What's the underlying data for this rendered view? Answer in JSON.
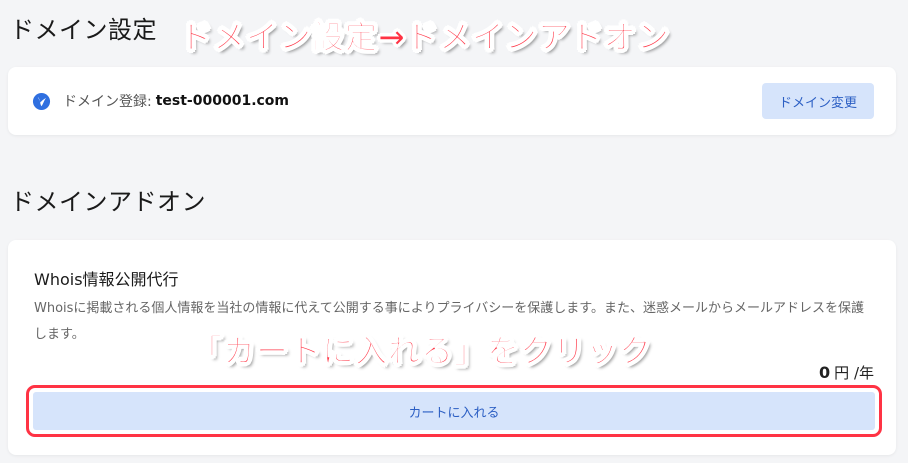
{
  "sections": {
    "domain_settings_title": "ドメイン設定",
    "domain_addon_title": "ドメインアドオン"
  },
  "annotations": {
    "top": "ドメイン設定→ドメインアドオン",
    "middle": "「カートに入れる」をクリック"
  },
  "domain_card": {
    "label": "ドメイン登録:",
    "value": "test-000001.com",
    "change_button": "ドメイン変更",
    "icon": "domain-logo-icon"
  },
  "addon_card": {
    "title": "Whois情報公開代行",
    "description": "Whoisに掲載される個人情報を当社の情報に代えて公開する事によりプライバシーを保護します。また、迷惑メールからメールアドレスを保護します。",
    "price_amount": "0",
    "price_unit": "円 /年",
    "cart_button": "カートに入れる"
  },
  "colors": {
    "accent": "#2c5fc4",
    "button_bg": "#d6e4fb",
    "annotation": "#ff3344"
  }
}
